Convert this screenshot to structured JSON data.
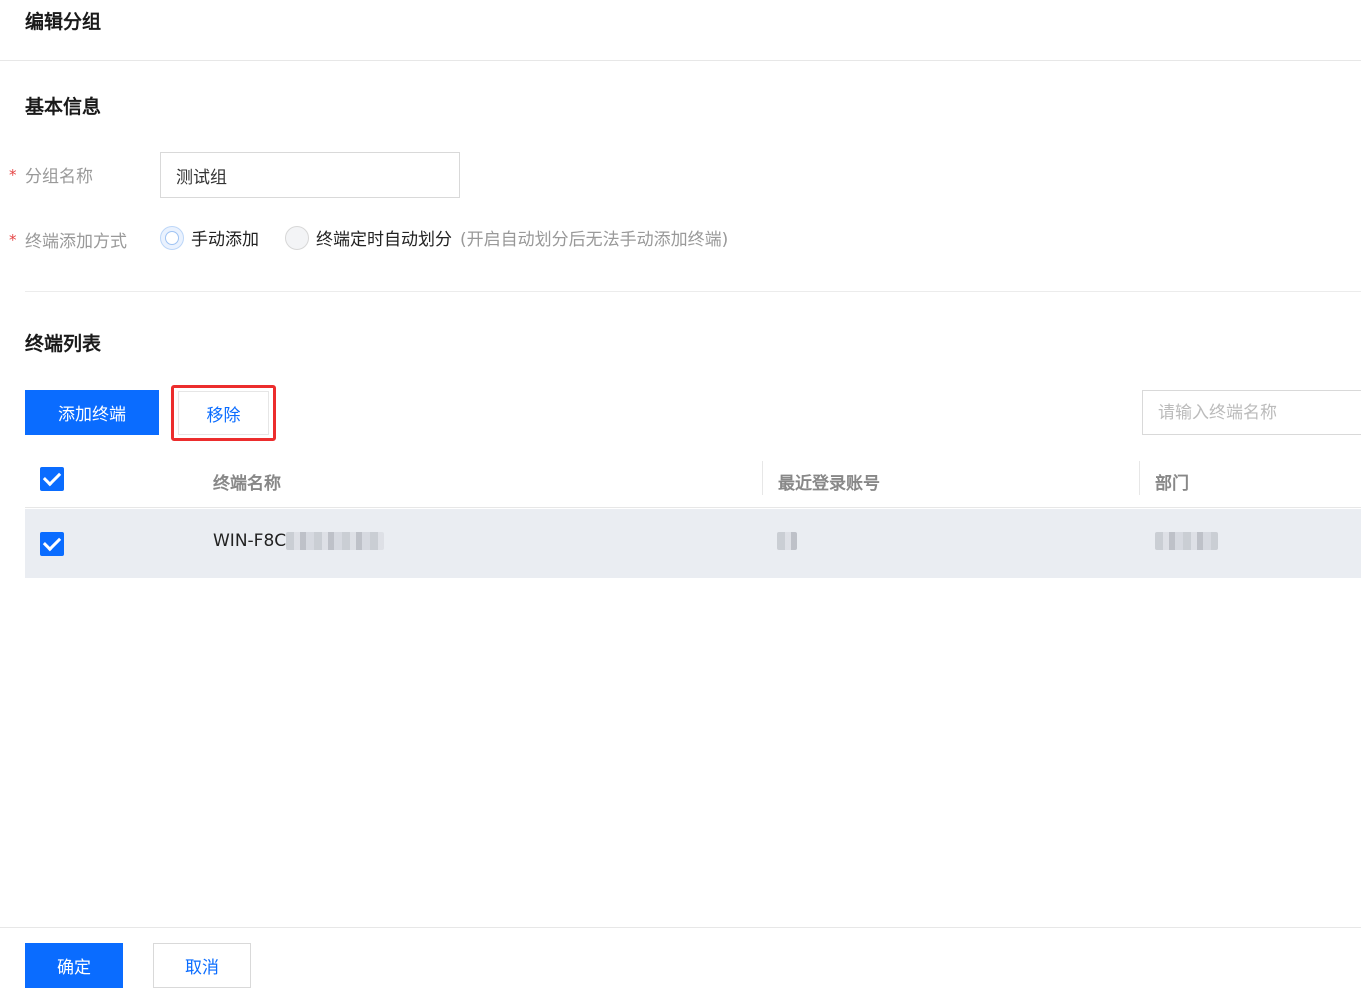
{
  "header": {
    "title": "编辑分组"
  },
  "basic_info": {
    "title": "基本信息",
    "required_mark": "*",
    "group_name": {
      "label": "分组名称",
      "value": "测试组"
    },
    "add_mode": {
      "label": "终端添加方式",
      "options": [
        {
          "label": "手动添加",
          "checked": true
        },
        {
          "label": "终端定时自动划分",
          "checked": false
        }
      ],
      "hint": "(开启自动划分后无法手动添加终端)"
    }
  },
  "terminal_list": {
    "title": "终端列表",
    "add_button": "添加终端",
    "remove_button": "移除",
    "search_placeholder": "请输入终端名称",
    "columns": [
      "终端名称",
      "最近登录账号",
      "部门"
    ],
    "rows": [
      {
        "name": "WIN-F8C",
        "checked": true
      }
    ],
    "header_checked": true
  },
  "footer": {
    "confirm": "确定",
    "cancel": "取消"
  },
  "colors": {
    "primary": "#0a6cff",
    "highlight_border": "#ec2d2d",
    "row_bg": "#eaedf2"
  }
}
